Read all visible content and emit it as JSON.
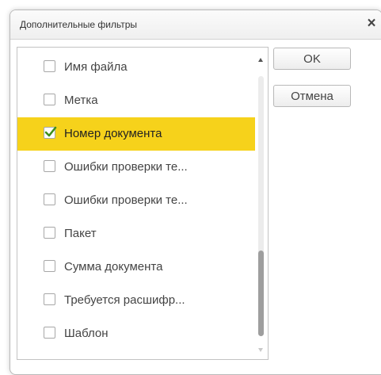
{
  "dialog": {
    "title": "Дополнительные фильтры",
    "close_glyph": "×"
  },
  "filters": [
    {
      "label": "Имя файла",
      "checked": false,
      "selected": false
    },
    {
      "label": "Метка",
      "checked": false,
      "selected": false
    },
    {
      "label": "Номер документа",
      "checked": true,
      "selected": true
    },
    {
      "label": "Ошибки проверки те...",
      "checked": false,
      "selected": false
    },
    {
      "label": "Ошибки проверки те...",
      "checked": false,
      "selected": false
    },
    {
      "label": "Пакет",
      "checked": false,
      "selected": false
    },
    {
      "label": "Сумма документа",
      "checked": false,
      "selected": false
    },
    {
      "label": "Требуется расшифр...",
      "checked": false,
      "selected": false
    },
    {
      "label": "Шаблон",
      "checked": false,
      "selected": false
    }
  ],
  "scroll": {
    "thumb_start": 0.67,
    "thumb_end": 1.0
  },
  "buttons": {
    "ok": "OK",
    "cancel": "Отмена"
  },
  "colors": {
    "selection": "#f6d21b",
    "check": "#3d8f1d"
  }
}
